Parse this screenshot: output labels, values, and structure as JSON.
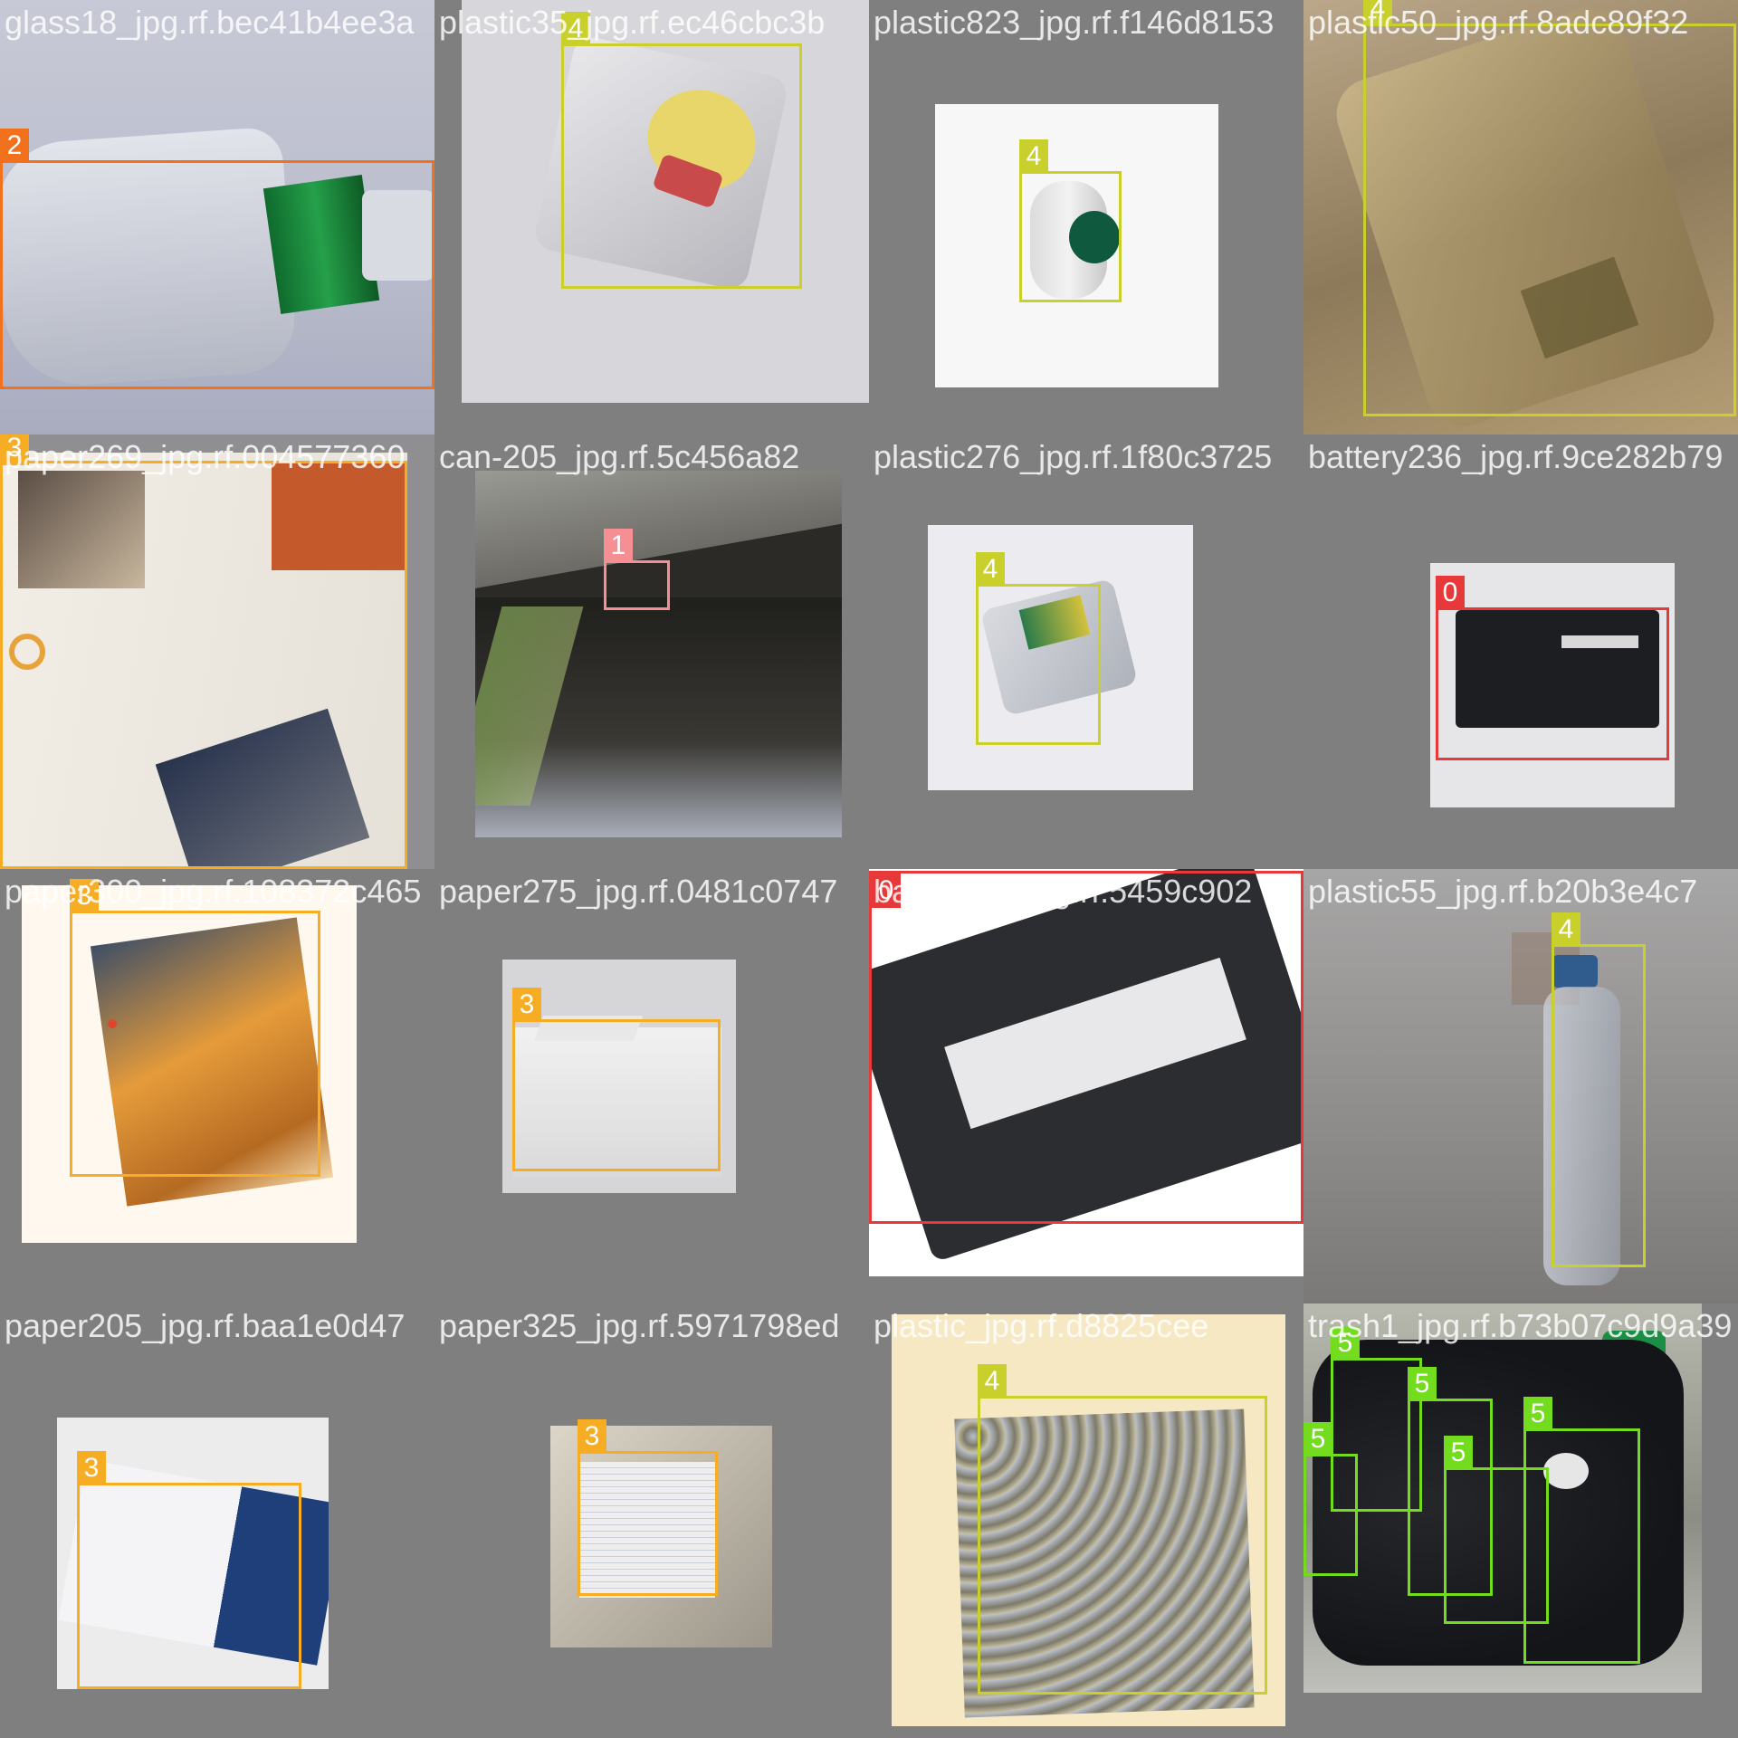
{
  "colors": {
    "class_0": "#e8393a",
    "class_1": "#f58f93",
    "class_2": "#f2711d",
    "class_3": "#f6ad24",
    "class_4": "#c9d02c",
    "class_5": "#74dc1e"
  },
  "tiles": [
    {
      "name": "glass18_jpg.rf.bec41b4ee3a",
      "labels": [
        "2"
      ],
      "scene": "glass bottle with green label"
    },
    {
      "name": "plastic35_jpg.rf.ec46cbc3b",
      "labels": [
        "4"
      ],
      "scene": "clear plastic berry container"
    },
    {
      "name": "plastic823_jpg.rf.f146d8153",
      "labels": [
        "4"
      ],
      "scene": "small plastic cap container"
    },
    {
      "name": "plastic50_jpg.rf.8adc89f32",
      "labels": [
        "4"
      ],
      "scene": "plastic tray"
    },
    {
      "name": "paper269_jpg.rf.004577360",
      "labels": [
        "3"
      ],
      "scene": "open magazine"
    },
    {
      "name": "can-205_jpg.rf.5c456a82",
      "labels": [
        "1"
      ],
      "scene": "can near water"
    },
    {
      "name": "plastic276_jpg.rf.1f80c3725",
      "labels": [
        "4"
      ],
      "scene": "plastic container"
    },
    {
      "name": "battery236_jpg.rf.9ce282b79",
      "labels": [
        "0"
      ],
      "scene": "laptop battery"
    },
    {
      "name": "paper300_jpg.rf.108372c465",
      "labels": [
        "3"
      ],
      "scene": "photo print"
    },
    {
      "name": "paper275_jpg.rf.0481c0747",
      "labels": [
        "3"
      ],
      "scene": "paper envelope"
    },
    {
      "name": "battery24_jpg.rf.5459c902",
      "labels": [
        "0"
      ],
      "scene": "laptop battery close-up"
    },
    {
      "name": "plastic55_jpg.rf.b20b3e4c7",
      "labels": [
        "4"
      ],
      "scene": "plastic water bottle"
    },
    {
      "name": "paper205_jpg.rf.baa1e0d47",
      "labels": [
        "3"
      ],
      "scene": "printed brochure"
    },
    {
      "name": "paper325_jpg.rf.5971798ed",
      "labels": [
        "3"
      ],
      "scene": "lined notebook page"
    },
    {
      "name": "plastic_jpg.rf.d8825cee",
      "labels": [
        "4"
      ],
      "scene": "crumpled foil bag"
    },
    {
      "name": "trash1_jpg.rf.b73b07c9d9a39",
      "labels": [
        "5",
        "5",
        "5",
        "5",
        "5"
      ],
      "scene": "black garbage bags"
    }
  ]
}
